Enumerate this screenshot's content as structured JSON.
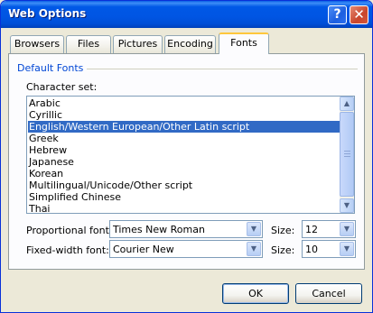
{
  "window": {
    "title": "Web Options",
    "help_icon": "help-icon",
    "close_icon": "close-icon"
  },
  "tabs": [
    {
      "label": "Browsers"
    },
    {
      "label": "Files"
    },
    {
      "label": "Pictures"
    },
    {
      "label": "Encoding"
    },
    {
      "label": "Fonts",
      "active": true
    }
  ],
  "panel": {
    "group_label": "Default Fonts",
    "charset_label": "Character set:",
    "charset_items": [
      "Arabic",
      "Cyrillic",
      "English/Western European/Other Latin script",
      "Greek",
      "Hebrew",
      "Japanese",
      "Korean",
      "Multilingual/Unicode/Other script",
      "Simplified Chinese",
      "Thai"
    ],
    "selected_charset": "English/Western European/Other Latin script",
    "proportional_label": "Proportional font:",
    "proportional_value": "Times New Roman",
    "proportional_size_label": "Size:",
    "proportional_size": "12",
    "fixed_label": "Fixed-width font:",
    "fixed_value": "Courier New",
    "fixed_size_label": "Size:",
    "fixed_size": "10"
  },
  "buttons": {
    "ok": "OK",
    "cancel": "Cancel"
  },
  "colors": {
    "titlebar": "#0054e3",
    "selection": "#316ac5",
    "group_label": "#0046d5",
    "active_tab_accent": "#ffc73c"
  }
}
